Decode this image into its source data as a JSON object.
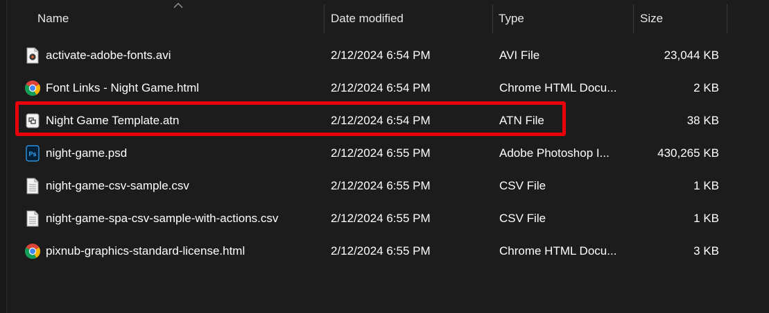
{
  "columns": {
    "name": "Name",
    "date": "Date modified",
    "type": "Type",
    "size": "Size"
  },
  "files": [
    {
      "name": "activate-adobe-fonts.avi",
      "date": "2/12/2024 6:54 PM",
      "type": "AVI File",
      "size": "23,044 KB",
      "icon": "video-file-icon"
    },
    {
      "name": "Font Links - Night Game.html",
      "date": "2/12/2024 6:54 PM",
      "type": "Chrome HTML Docu...",
      "size": "2 KB",
      "icon": "chrome-icon"
    },
    {
      "name": "Night Game Template.atn",
      "date": "2/12/2024 6:54 PM",
      "type": "ATN File",
      "size": "38 KB",
      "icon": "action-file-icon",
      "highlighted": true
    },
    {
      "name": "night-game.psd",
      "date": "2/12/2024 6:55 PM",
      "type": "Adobe Photoshop I...",
      "size": "430,265 KB",
      "icon": "photoshop-icon"
    },
    {
      "name": "night-game-csv-sample.csv",
      "date": "2/12/2024 6:55 PM",
      "type": "CSV File",
      "size": "1 KB",
      "icon": "text-file-icon"
    },
    {
      "name": "night-game-spa-csv-sample-with-actions.csv",
      "date": "2/12/2024 6:55 PM",
      "type": "CSV File",
      "size": "1 KB",
      "icon": "text-file-icon"
    },
    {
      "name": "pixnub-graphics-standard-license.html",
      "date": "2/12/2024 6:55 PM",
      "type": "Chrome HTML Docu...",
      "size": "3 KB",
      "icon": "chrome-icon"
    }
  ],
  "colors": {
    "background": "#1c1c1c",
    "highlight_border": "#e8000b",
    "photoshop_blue": "#31a8ff"
  }
}
